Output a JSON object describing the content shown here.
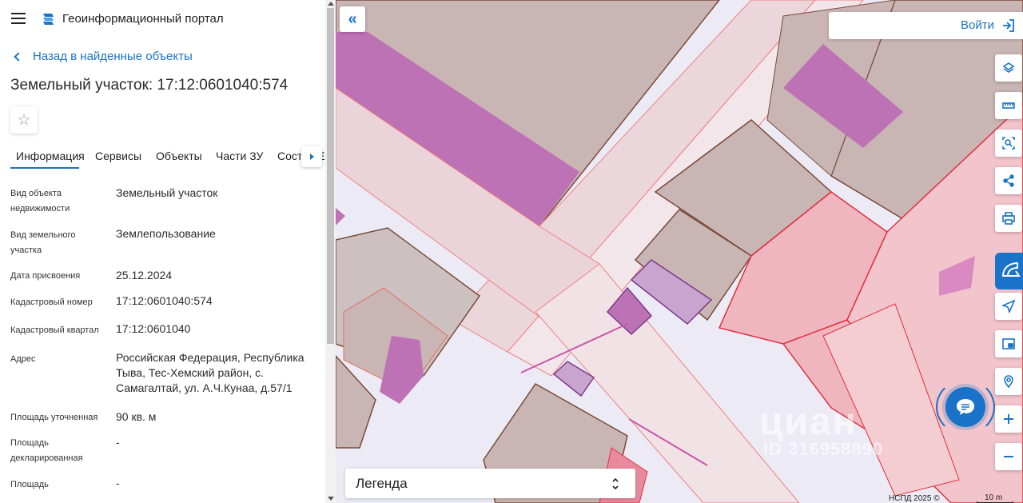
{
  "header": {
    "menu_icon": "hamburger-menu-icon",
    "logo_icon": "portal-logo-icon",
    "title": "Геоинформационный портал"
  },
  "back_link": {
    "label": "Назад в найденные объекты",
    "icon": "chevron-left-icon"
  },
  "object": {
    "title": "Земельный участок: 17:12:0601040:574",
    "favorite_icon": "star-outline-icon"
  },
  "tabs": [
    {
      "label": "Информация",
      "active": true
    },
    {
      "label": "Сервисы",
      "active": false
    },
    {
      "label": "Объекты",
      "active": false
    },
    {
      "label": "Части ЗУ",
      "active": false
    },
    {
      "label": "Состав ЕЗ",
      "active": false
    }
  ],
  "tabs_next_icon": "chevron-right-icon",
  "info": [
    {
      "label": "Вид объекта недвижимости",
      "value": "Земельный участок"
    },
    {
      "label": "Вид земельного участка",
      "value": "Землепользование"
    },
    {
      "label": "Дата присвоения",
      "value": "25.12.2024"
    },
    {
      "label": "Кадастровый номер",
      "value": "17:12:0601040:574"
    },
    {
      "label": "Кадастровый квартал",
      "value": "17:12:0601040"
    },
    {
      "label": "Адрес",
      "value": "Российская Федерация, Республика Тыва, Тес-Хемский район, с. Самагалтай, ул. А.Ч.Кунаа, д.57/1"
    },
    {
      "label": "Площадь уточненная",
      "value": "90 кв. м"
    },
    {
      "label": "Площадь декларированная",
      "value": "-"
    },
    {
      "label": "Площадь",
      "value": "-"
    }
  ],
  "map": {
    "collapse_icon": "double-chevron-left-icon",
    "login": {
      "label": "Войти",
      "icon": "login-icon"
    },
    "tools": [
      {
        "name": "layers",
        "icon": "layers-icon"
      },
      {
        "name": "measure",
        "icon": "ruler-icon"
      },
      {
        "name": "select-area",
        "icon": "area-search-icon"
      },
      {
        "name": "share",
        "icon": "share-icon"
      },
      {
        "name": "print",
        "icon": "printer-icon"
      },
      {
        "name": "navigate",
        "icon": "navigation-arrow-icon"
      },
      {
        "name": "minimap",
        "icon": "picture-in-picture-icon"
      },
      {
        "name": "geolocation",
        "icon": "geolocation-icon"
      },
      {
        "name": "zoom-in",
        "icon": "plus-icon"
      },
      {
        "name": "zoom-out",
        "icon": "minus-icon"
      }
    ],
    "cian_badge_icon": "cian-logo-icon",
    "chat_icon": "chat-bubble-icon",
    "legend": {
      "label": "Легенда",
      "icon": "sort-arrows-icon"
    },
    "watermark": {
      "text": "циан",
      "id": "ID 316958890"
    },
    "attribution": "НСПД 2025 ©",
    "scale": "10 m",
    "colors": {
      "accent": "#1a73c8",
      "parcel_fill": "#c9b5b3",
      "building_fill": "#bd72b5",
      "road_fill": "#ecebf5",
      "zone_fill": "#efb6c0",
      "zone_stroke": "#e0313f",
      "selected_fill": "#c8a4cf"
    }
  }
}
